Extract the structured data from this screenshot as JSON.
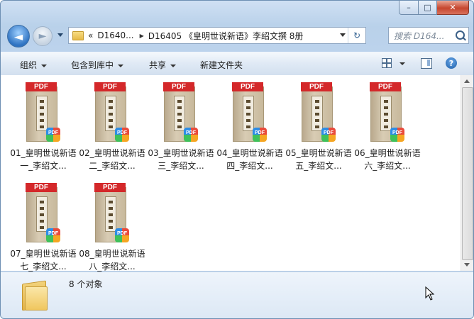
{
  "window": {
    "controls": {
      "minimize": "–",
      "maximize": "□",
      "close": "✕"
    }
  },
  "navigation": {
    "back_icon": "back-arrow-icon",
    "forward_icon": "forward-arrow-icon",
    "breadcrumb": [
      {
        "label": "«"
      },
      {
        "label": "D1640..."
      },
      {
        "label": "D16405 《皇明世说新语》李绍文撰 8册"
      }
    ],
    "search_placeholder": "搜索 D164..."
  },
  "toolbar": {
    "items": [
      {
        "label": "组织",
        "has_menu": true
      },
      {
        "label": "包含到库中",
        "has_menu": true
      },
      {
        "label": "共享",
        "has_menu": true
      },
      {
        "label": "新建文件夹",
        "has_menu": false
      }
    ]
  },
  "files": [
    {
      "name": "01_皇明世说新语一_李绍文...",
      "tag": "PDF"
    },
    {
      "name": "02_皇明世说新语二_李绍文...",
      "tag": "PDF"
    },
    {
      "name": "03_皇明世说新语三_李绍文...",
      "tag": "PDF"
    },
    {
      "name": "04_皇明世说新语四_李绍文...",
      "tag": "PDF"
    },
    {
      "name": "05_皇明世说新语五_李绍文...",
      "tag": "PDF"
    },
    {
      "name": "06_皇明世说新语六_李绍文...",
      "tag": "PDF"
    },
    {
      "name": "07_皇明世说新语七_李绍文...",
      "tag": "PDF"
    },
    {
      "name": "08_皇明世说新语八_李绍文...",
      "tag": "PDF"
    }
  ],
  "status": {
    "text": "8 个对象"
  },
  "colors": {
    "pdf_red": "#d4282a",
    "frame_blue": "#b9d1ea"
  }
}
